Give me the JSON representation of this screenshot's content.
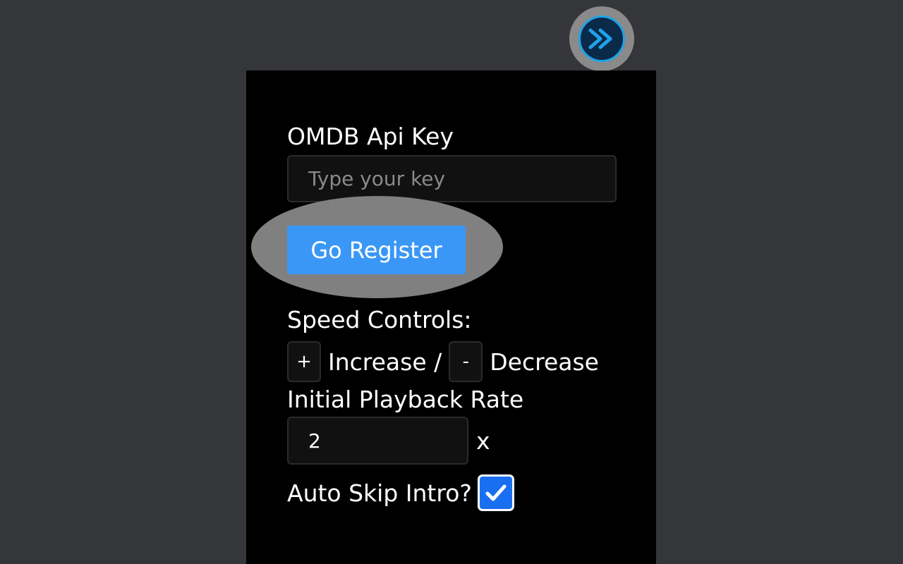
{
  "extension": {
    "icon": "fast-forward-icon",
    "accent_color": "#1ea3e8"
  },
  "popup": {
    "api_key_label": "OMDB Api Key",
    "api_key_placeholder": "Type your key",
    "api_key_value": "",
    "register_button_label": "Go Register",
    "speed_controls_label": "Speed Controls:",
    "increase_key": "+",
    "increase_label": "Increase /",
    "decrease_key": "-",
    "decrease_label": "Decrease",
    "playback_rate_label": "Initial Playback Rate",
    "playback_rate_value": "2",
    "playback_rate_unit": "x",
    "auto_skip_label": "Auto Skip Intro?",
    "auto_skip_checked": true,
    "button_color": "#3a97f6",
    "checkbox_color": "#1a6ff0"
  }
}
